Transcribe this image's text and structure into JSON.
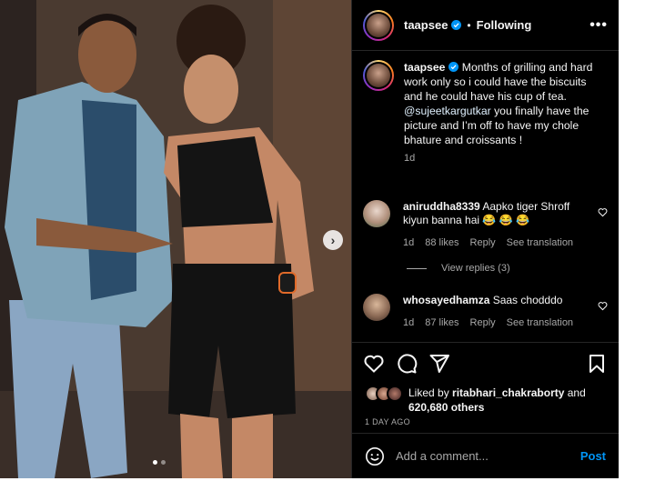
{
  "post": {
    "username": "taapsee",
    "separator": "•",
    "follow_status": "Following",
    "more_icon": "more-horizontal-icon",
    "caption": {
      "username": "taapsee",
      "text_1": " Months of grilling and hard work only so i could have the biscuits and he could have his cup of tea.",
      "mention": "@sujeetkargutkar",
      "text_2": " you finally have the picture and I’m off to have my chole bhature and croissants !",
      "time": "1d"
    },
    "carousel": {
      "next_icon": "chevron-right-icon",
      "dots": 2,
      "active_dot": 0
    }
  },
  "comments": [
    {
      "username": "aniruddha8339",
      "text": " Aapko tiger Shroff kiyun banna hai",
      "emoji": "😂 😂 😂",
      "time": "1d",
      "likes": "88 likes",
      "reply": "Reply",
      "translate": "See translation",
      "view_replies": "View replies (3)"
    },
    {
      "username": "whosayedhamza",
      "text": " Saas chodddo",
      "time": "1d",
      "likes": "87 likes",
      "reply": "Reply",
      "translate": "See translation"
    }
  ],
  "actions": [
    "heart-icon",
    "comment-icon",
    "share-icon",
    "bookmark-icon"
  ],
  "likes": {
    "prefix": "Liked by ",
    "user": "ritabhari_chakraborty",
    "middle": " and",
    "count": "620,680 others"
  },
  "date": "1 DAY AGO",
  "add_comment": {
    "placeholder": "Add a comment...",
    "post_label": "Post",
    "emoji_icon": "emoji-icon"
  },
  "colors": {
    "accent": "#0095f6",
    "background": "#000000",
    "muted": "#a8a8a8",
    "verified": "#0095f6"
  }
}
